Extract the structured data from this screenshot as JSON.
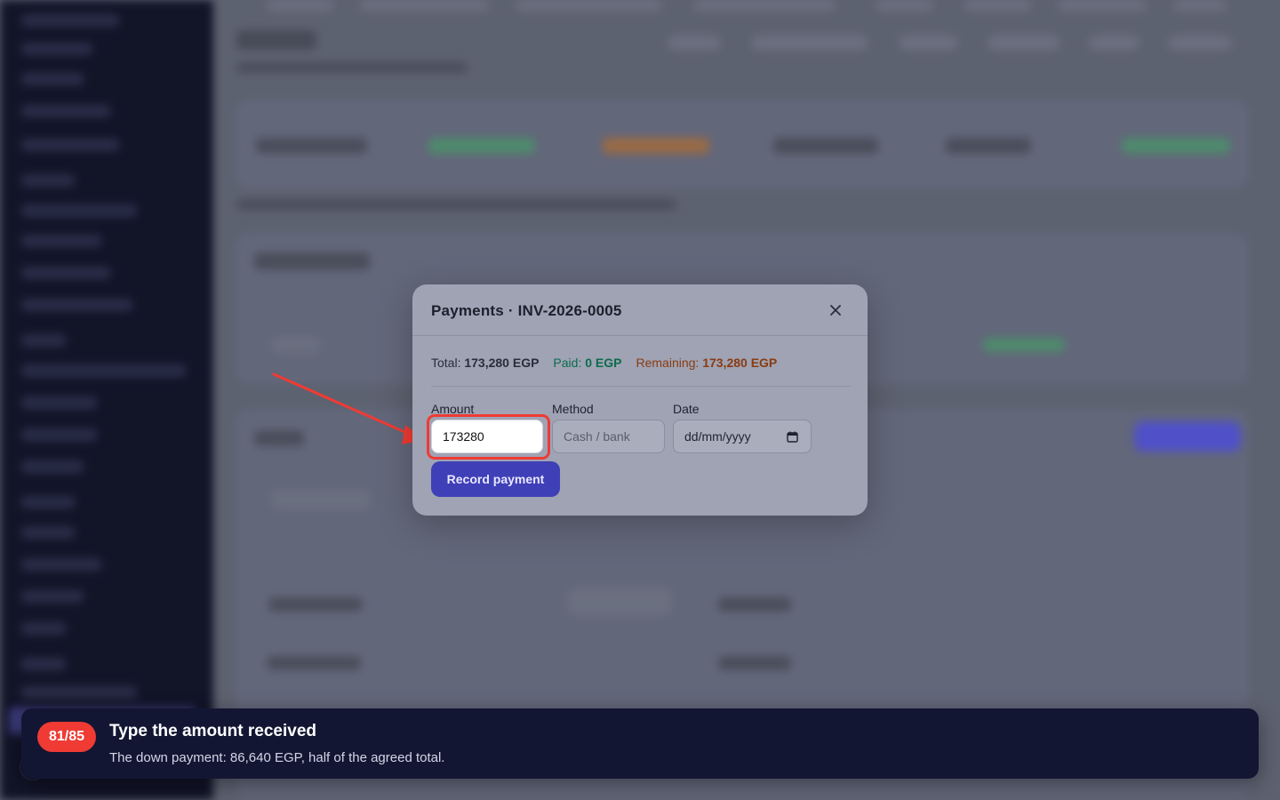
{
  "modal": {
    "title": "Payments · INV-2026-0005",
    "summary": {
      "total_label": "Total:",
      "total_value": "173,280 EGP",
      "paid_label": "Paid:",
      "paid_value": "0 EGP",
      "remaining_label": "Remaining:",
      "remaining_value": "173,280 EGP"
    },
    "fields": {
      "amount_label": "Amount",
      "amount_value": "173280",
      "method_label": "Method",
      "method_placeholder": "Cash / bank",
      "date_label": "Date",
      "date_placeholder": "dd/mm/yyyy"
    },
    "record_button": "Record payment",
    "close_icon": "close-icon"
  },
  "toast": {
    "step": "81/85",
    "title": "Type the amount received",
    "description": "The down payment: 86,640 EGP, half of the agreed total."
  },
  "colors": {
    "accent": "#3f3fb8",
    "highlight": "#ef3b34",
    "paid": "#0d6b4e",
    "remaining": "#8a3b12"
  }
}
